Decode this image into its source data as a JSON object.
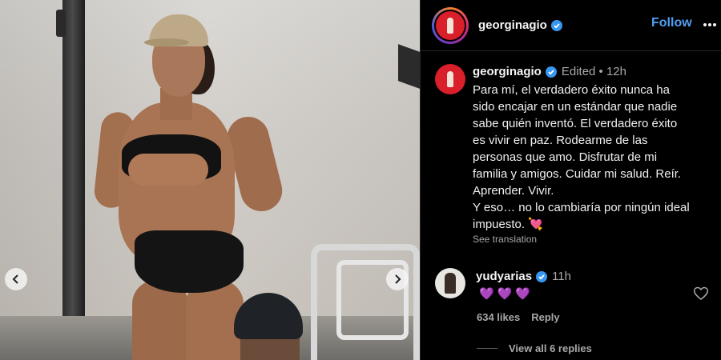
{
  "media": {
    "prev_icon": "chevron-left-icon",
    "next_icon": "chevron-right-icon"
  },
  "header": {
    "username": "georginagio",
    "verified_icon": "verified-badge-icon",
    "follow_label": "Follow",
    "more_icon": "more-horizontal-icon"
  },
  "caption": {
    "username": "georginagio",
    "meta": "Edited • 12h",
    "lines": [
      "Para mí, el verdadero éxito nunca ha",
      "sido encajar en un estándar que nadie",
      "sabe quién inventó. El verdadero éxito",
      "es vivir en paz. Rodearme de las",
      "personas que amo. Disfrutar de mi",
      "familia y amigos. Cuidar mi salud. Reír.",
      "Aprender. Vivir.",
      "Y eso… no lo cambiaría por ningún ideal",
      "impuesto. 💘"
    ],
    "see_translation": "See translation"
  },
  "comment": {
    "username": "yudyarias",
    "time": "11h",
    "text": "💜💜💜",
    "likes": "634 likes",
    "reply_label": "Reply",
    "like_icon": "heart-outline-icon"
  },
  "view_replies": "View all 6 replies",
  "colors": {
    "accent": "#4f9ff5",
    "background": "#000000",
    "muted_text": "#a8a8a8",
    "avatar_red": "#d81f2a"
  }
}
